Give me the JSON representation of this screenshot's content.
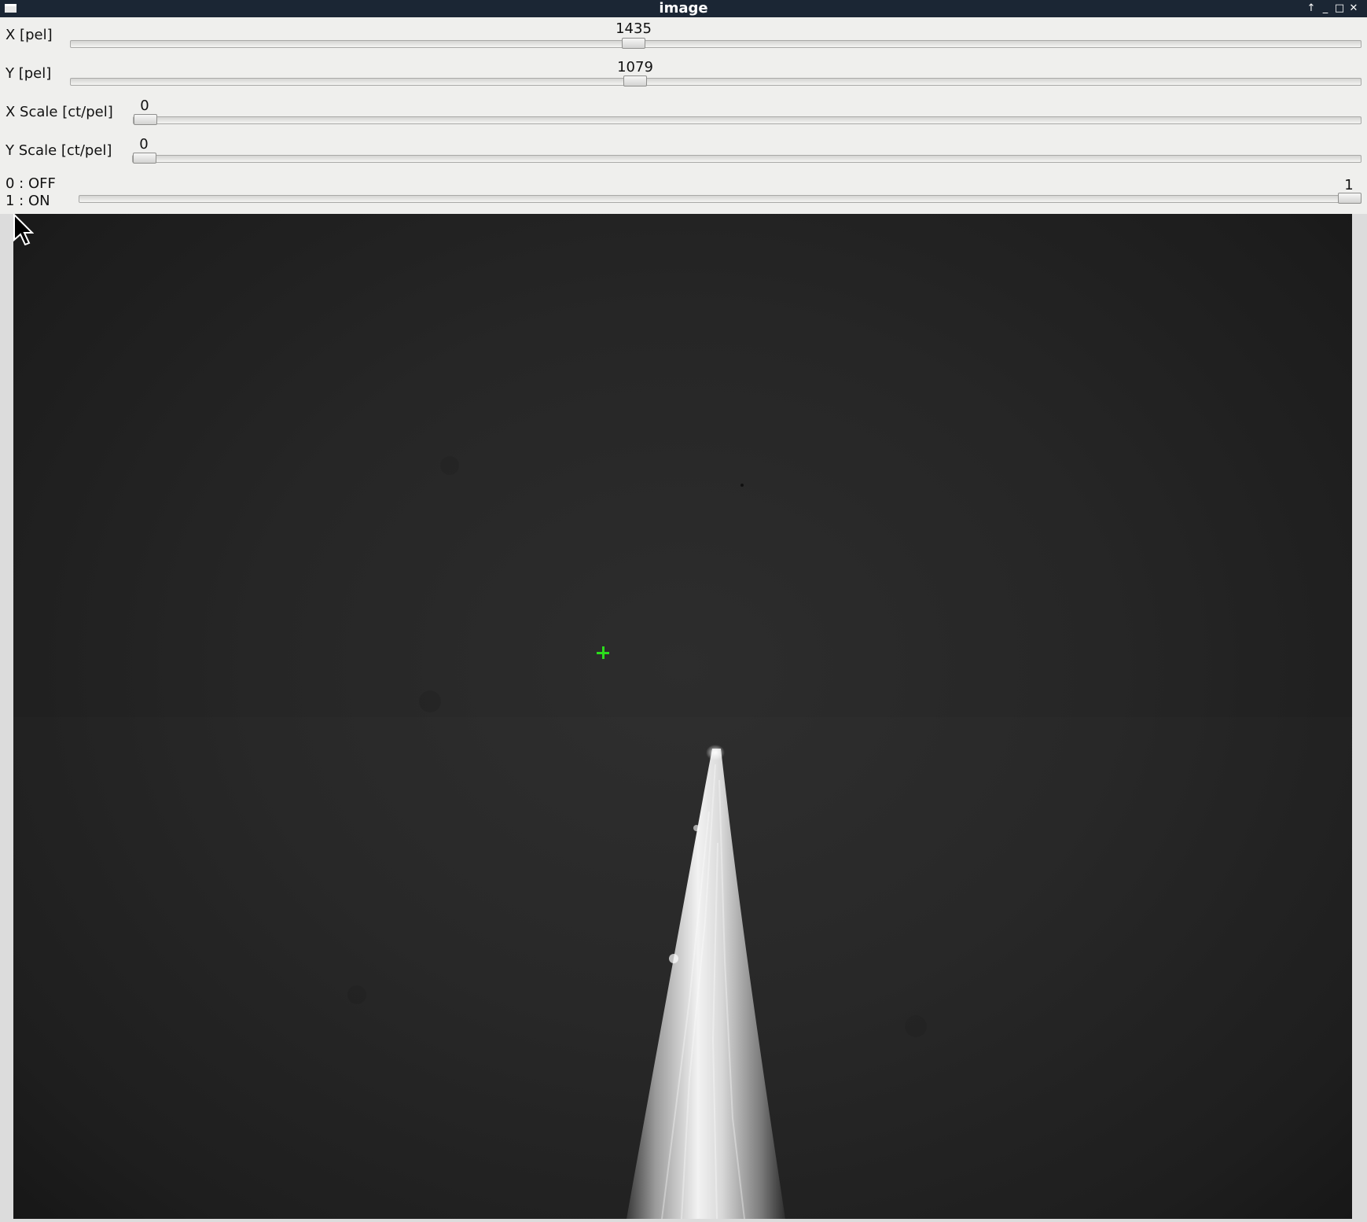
{
  "window": {
    "title": "image",
    "buttons": {
      "raise": "↑",
      "minimize": "_",
      "maximize": "□",
      "close": "✕"
    }
  },
  "controls": {
    "x": {
      "label": "X [pel]",
      "value": "1435"
    },
    "y": {
      "label": "Y [pel]",
      "value": "1079"
    },
    "x_scale": {
      "label": "X Scale [ct/pel]",
      "value": "0"
    },
    "y_scale": {
      "label": "Y Scale [ct/pel]",
      "value": "0"
    },
    "toggle": {
      "label_off": "0 : OFF",
      "label_on": "1 : ON",
      "value": "1"
    }
  },
  "colors": {
    "titlebar": "#1b2634",
    "panel": "#efefed",
    "crosshair": "#2bdc1c"
  },
  "icons": {
    "window_menu": "window-menu-icon",
    "cursor": "mouse-pointer-icon",
    "crosshair": "crosshair-icon"
  }
}
